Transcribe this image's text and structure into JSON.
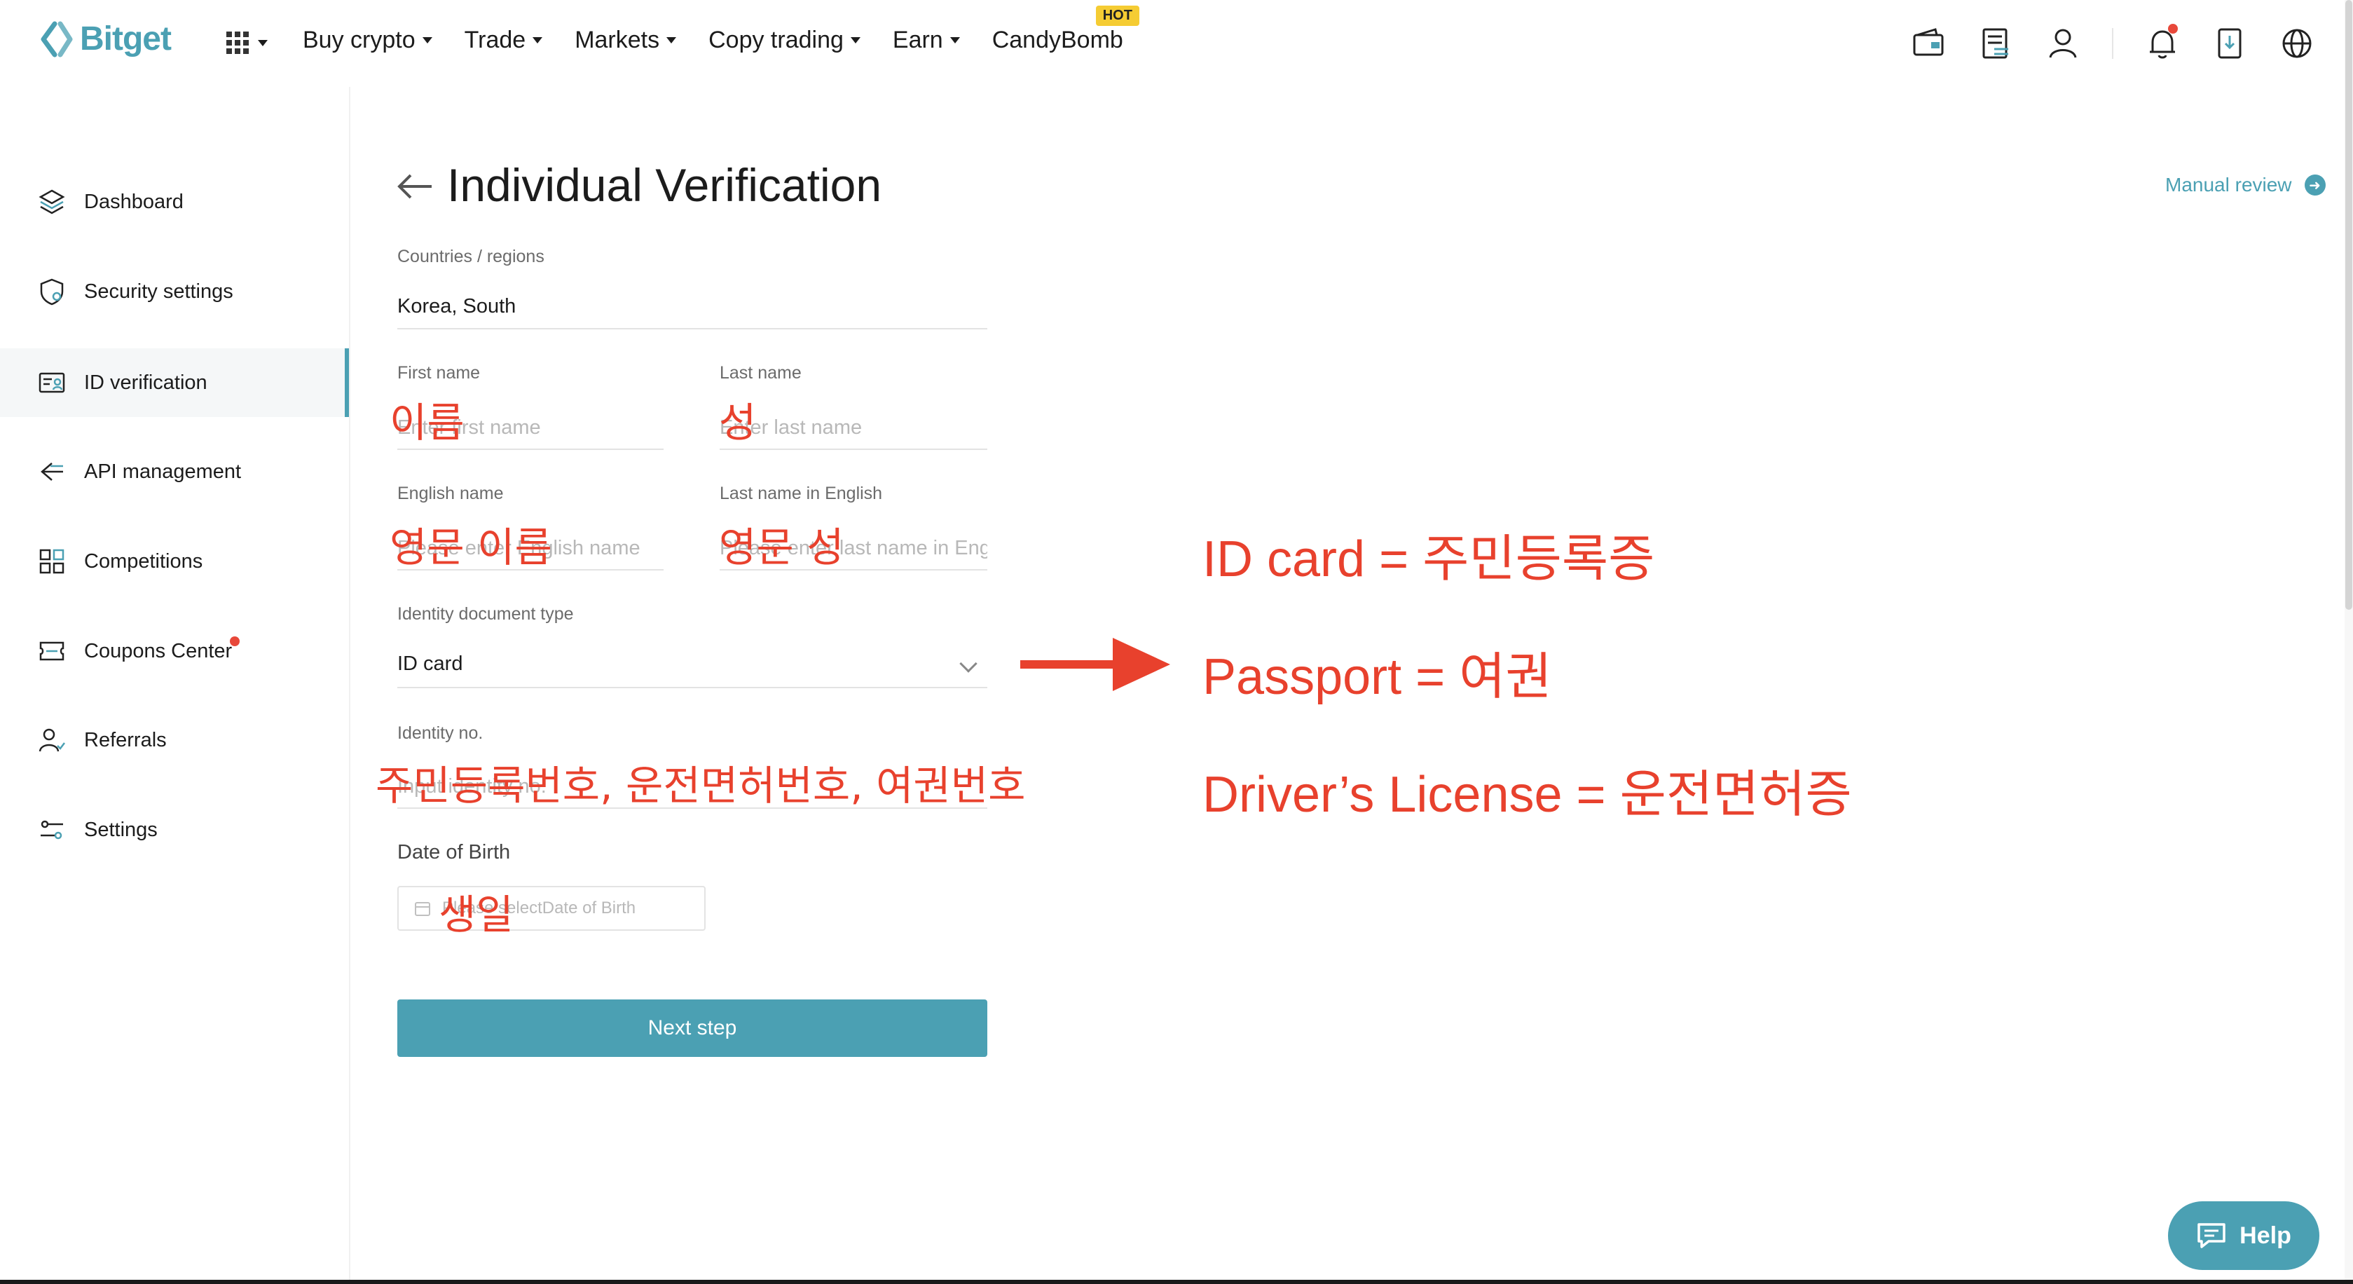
{
  "brand": {
    "name": "Bitget",
    "accent": "#4ba0b3",
    "annotation_color": "#e8412d"
  },
  "nav": {
    "items": [
      {
        "label": "Buy crypto",
        "dropdown": true
      },
      {
        "label": "Trade",
        "dropdown": true
      },
      {
        "label": "Markets",
        "dropdown": true
      },
      {
        "label": "Copy trading",
        "dropdown": true
      },
      {
        "label": "Earn",
        "dropdown": true
      },
      {
        "label": "CandyBomb",
        "dropdown": false,
        "badge": "HOT"
      }
    ],
    "icons": [
      "wallet-icon",
      "orders-icon",
      "user-icon",
      "bell-icon",
      "download-icon",
      "globe-icon"
    ]
  },
  "sidebar": {
    "items": [
      {
        "label": "Dashboard",
        "icon": "layers-icon"
      },
      {
        "label": "Security settings",
        "icon": "shield-icon"
      },
      {
        "label": "ID verification",
        "icon": "id-card-icon",
        "active": true
      },
      {
        "label": "API management",
        "icon": "api-icon"
      },
      {
        "label": "Competitions",
        "icon": "grid-icon"
      },
      {
        "label": "Coupons Center",
        "icon": "coupon-icon",
        "dot": true
      },
      {
        "label": "Referrals",
        "icon": "referrals-icon"
      },
      {
        "label": "Settings",
        "icon": "sliders-icon"
      }
    ]
  },
  "main": {
    "title": "Individual Verification",
    "manual_review": "Manual review",
    "country": {
      "label": "Countries / regions",
      "value": "Korea, South"
    },
    "first_name": {
      "label": "First name",
      "placeholder": "Enter first name"
    },
    "last_name": {
      "label": "Last name",
      "placeholder": "Enter last name"
    },
    "english_name": {
      "label": "English name",
      "placeholder": "Please enter English name"
    },
    "last_name_en": {
      "label": "Last name in English",
      "placeholder": "Please enter last name in English"
    },
    "doc_type": {
      "label": "Identity document type",
      "value": "ID card"
    },
    "identity_no": {
      "label": "Identity no.",
      "placeholder": "Input identity no."
    },
    "dob": {
      "label": "Date of Birth",
      "placeholder": "Please selectDate of Birth"
    },
    "next_button": "Next step"
  },
  "annotations": {
    "first_name": "이름",
    "last_name": "성",
    "english_name": "영문 이름",
    "last_name_en": "영문 성",
    "identity_no": "주민등록번호, 운전면허번호, 여권번호",
    "dob": "생일",
    "id_card": "ID card = 주민등록증",
    "passport": "Passport = 여권",
    "license": "Driver’s License = 운전면허증"
  },
  "help_button": "Help"
}
